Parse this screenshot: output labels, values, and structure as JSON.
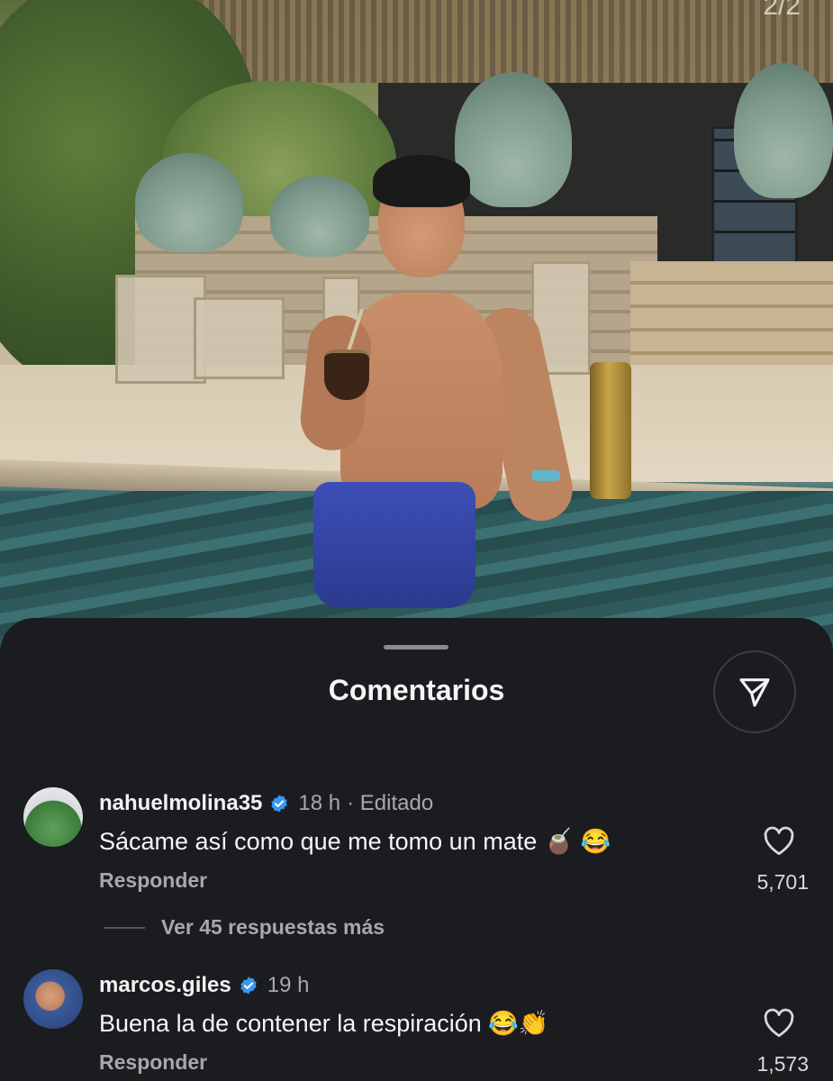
{
  "photo": {
    "page_indicator": "2/2"
  },
  "sheet": {
    "title": "Comentarios",
    "send_icon": "paper-plane-icon"
  },
  "comments": [
    {
      "username": "nahuelmolina35",
      "verified": true,
      "time": "18 h",
      "edited": "· Editado",
      "text": "Sácame así como que me tomo un mate 🧉 😂",
      "reply_label": "Responder",
      "likes": "5,701",
      "view_replies": "Ver 45 respuestas más"
    },
    {
      "username": "marcos.giles",
      "verified": true,
      "time": "19 h",
      "text": "Buena la de contener la respiración 😂👏",
      "reply_label": "Responder",
      "likes": "1,573"
    }
  ],
  "colors": {
    "sheet_bg": "#1b1c20",
    "verified_blue": "#3897f0",
    "secondary_text": "#a8a8ab"
  }
}
